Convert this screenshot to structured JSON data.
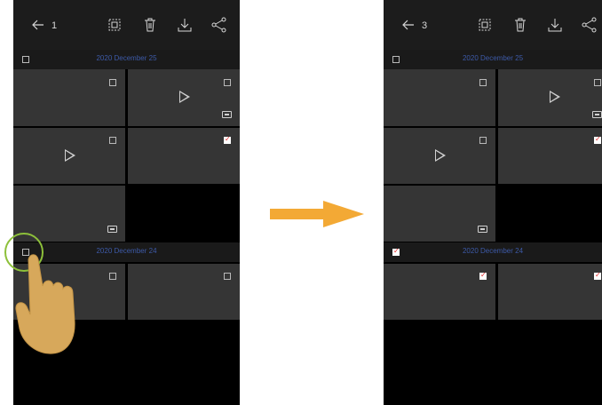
{
  "left_screen": {
    "toolbar": {
      "selected_count": "1",
      "icons": [
        "back-arrow",
        "select-all",
        "delete",
        "download",
        "share"
      ]
    },
    "sections": [
      {
        "date": "2020 December 25",
        "checked": false
      },
      {
        "date": "2020 December 24",
        "checked": false
      }
    ],
    "tiles": [
      {
        "type": "photo",
        "checked": false
      },
      {
        "type": "video",
        "checked": false,
        "badge": "film"
      },
      {
        "type": "video",
        "checked": false
      },
      {
        "type": "photo",
        "checked": true
      },
      {
        "type": "photo",
        "checked": false,
        "badge": "screen"
      },
      {
        "type": "photo",
        "checked": false
      },
      {
        "type": "photo",
        "checked": false
      }
    ]
  },
  "right_screen": {
    "toolbar": {
      "selected_count": "3",
      "icons": [
        "back-arrow",
        "select-all",
        "delete",
        "download",
        "share"
      ]
    },
    "sections": [
      {
        "date": "2020 December 25",
        "checked": false
      },
      {
        "date": "2020 December 24",
        "checked": true
      }
    ],
    "tiles": [
      {
        "type": "photo",
        "checked": false
      },
      {
        "type": "video",
        "checked": false,
        "badge": "film"
      },
      {
        "type": "video",
        "checked": false
      },
      {
        "type": "photo",
        "checked": true
      },
      {
        "type": "photo",
        "checked": false,
        "badge": "screen"
      },
      {
        "type": "photo",
        "checked": true
      },
      {
        "type": "photo",
        "checked": true
      }
    ]
  },
  "colors": {
    "accent_arrow": "#f3a935",
    "highlight_ring": "#8dc03a",
    "date_text": "#3d5aa8",
    "check_mark": "#e02424"
  }
}
